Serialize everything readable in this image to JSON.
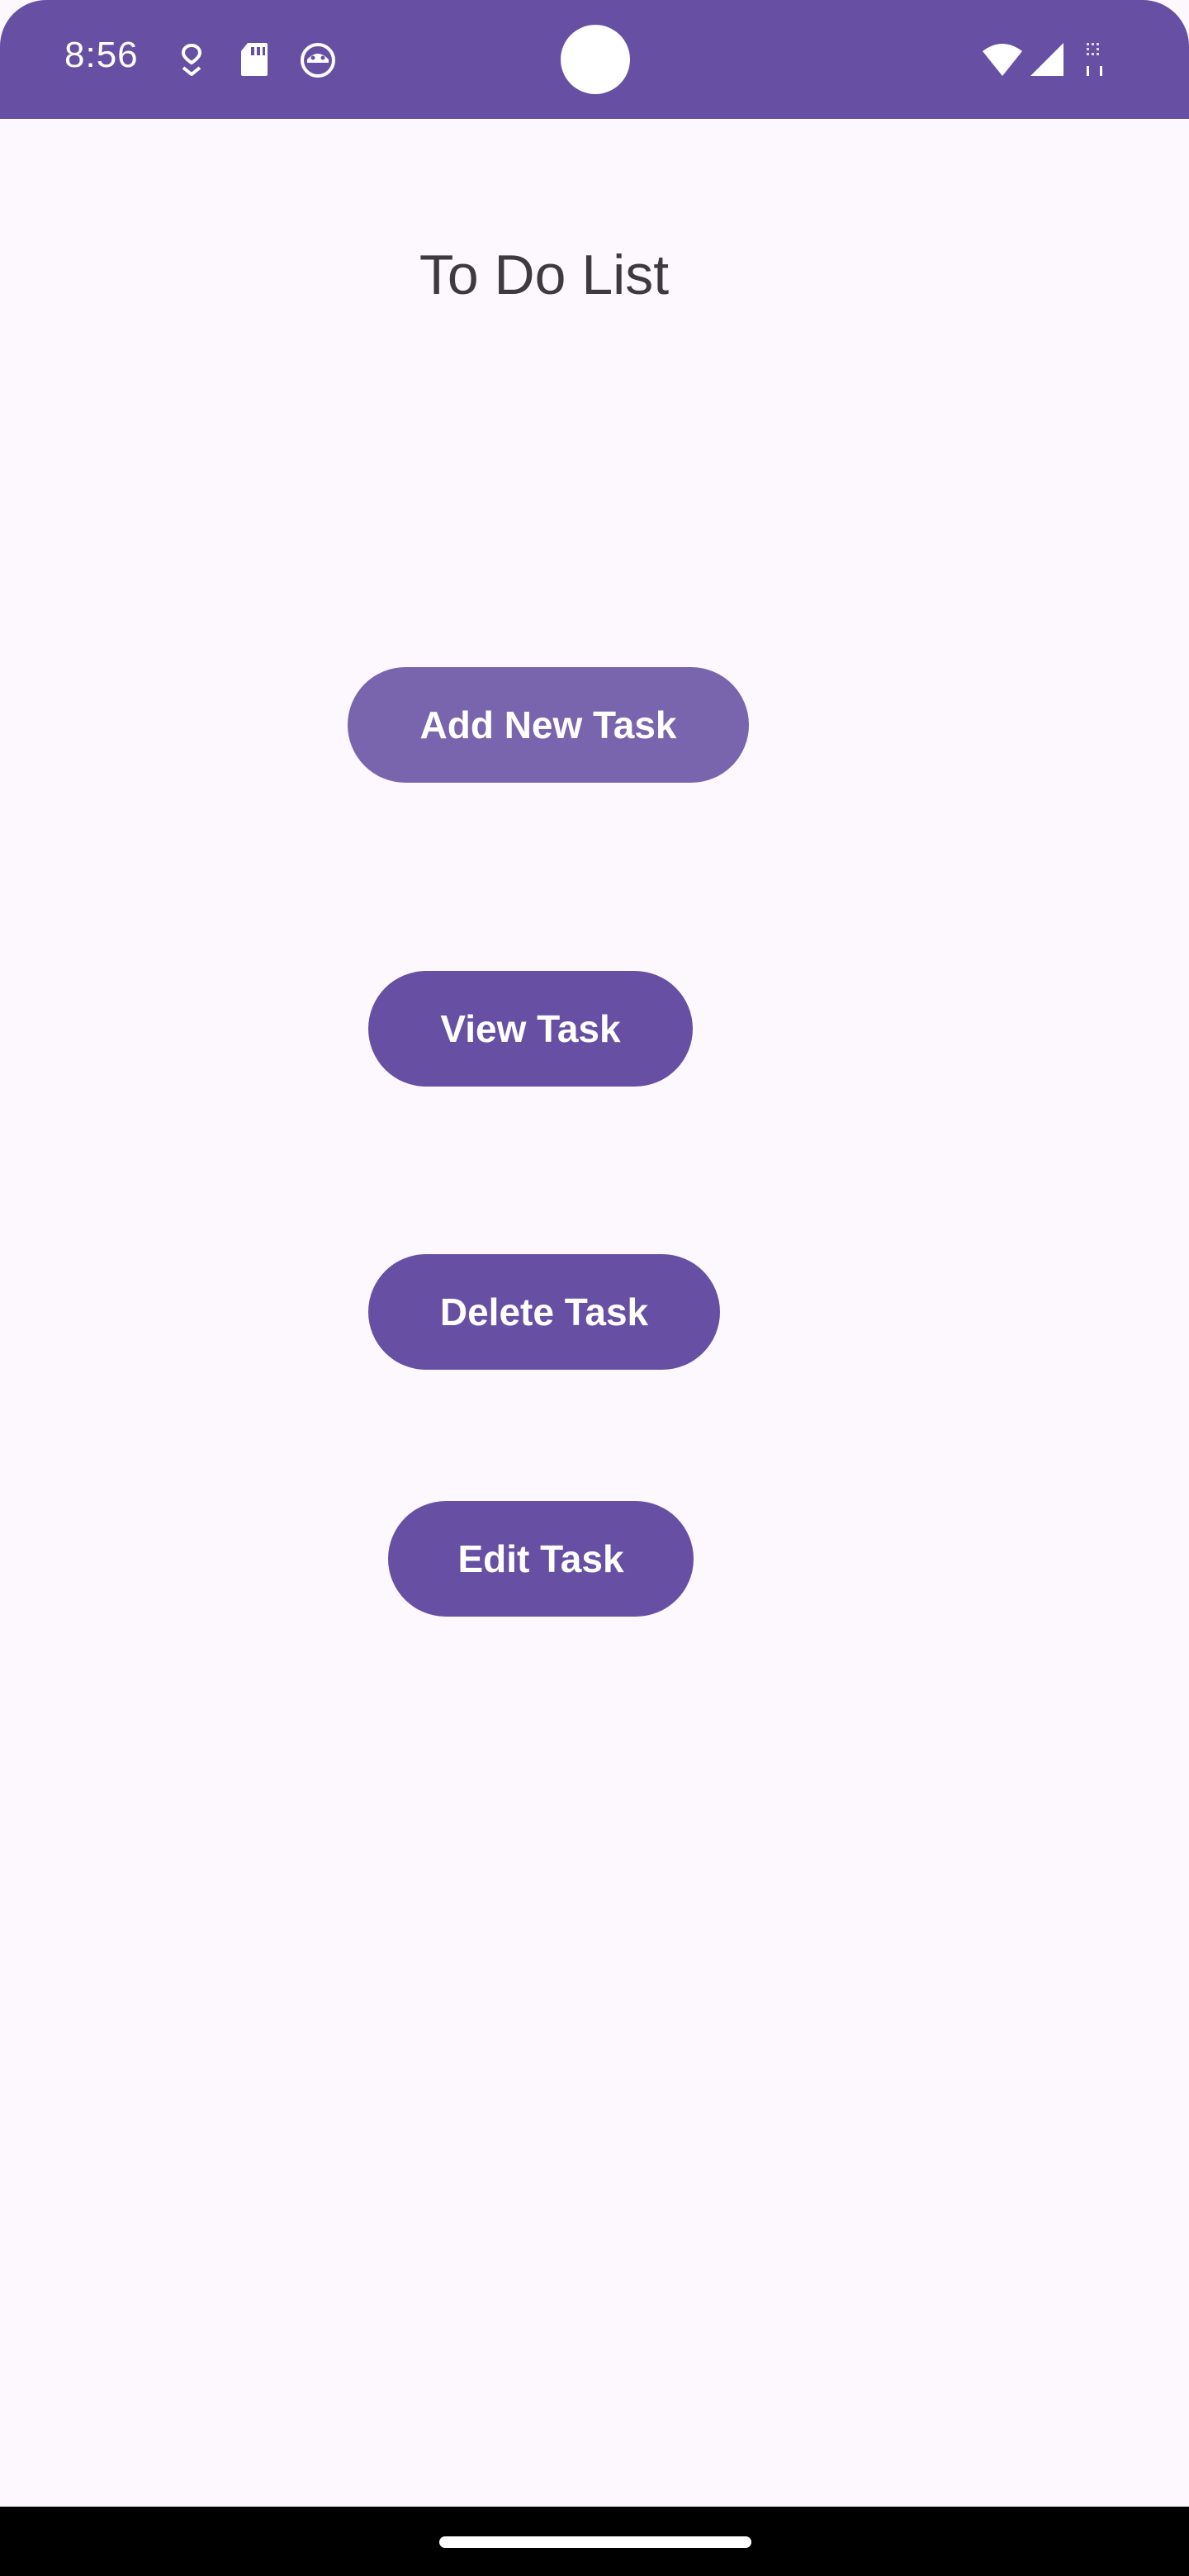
{
  "status_bar": {
    "time": "8:56",
    "left_icons": [
      "location-pin-icon",
      "sd-card-icon",
      "android-face-icon"
    ],
    "right_icons": [
      "wifi-icon",
      "cellular-signal-icon",
      "no-sim-icon"
    ],
    "color": "#6750a4"
  },
  "main": {
    "title": "To Do List",
    "buttons": {
      "add": "Add New Task",
      "view": "View Task",
      "delete": "Delete Task",
      "edit": "Edit Task"
    },
    "button_color": "#6750a4",
    "background_color": "#fdf7fe"
  }
}
